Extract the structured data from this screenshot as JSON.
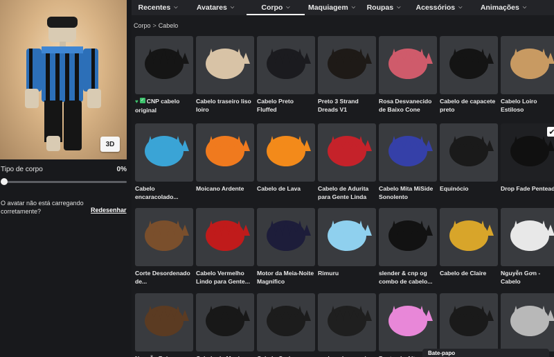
{
  "tabs": [
    {
      "label": "Recentes",
      "active": false
    },
    {
      "label": "Avatares",
      "active": false
    },
    {
      "label": "Corpo",
      "active": true
    },
    {
      "label": "Maquiagem",
      "active": false
    },
    {
      "label": "Roupas",
      "active": false
    },
    {
      "label": "Acessórios",
      "active": false
    },
    {
      "label": "Animações",
      "active": false
    }
  ],
  "avatar": {
    "view_button": "3D"
  },
  "body_type": {
    "label": "Tipo de corpo",
    "value": "0%",
    "value_fraction": 0
  },
  "loading": {
    "message": "O avatar não está carregando corretamente?",
    "redraw": "Redesenhar"
  },
  "breadcrumb": {
    "root": "Corpo",
    "separator": ">",
    "current": "Cabelo"
  },
  "items": [
    {
      "name": "CNP cabelo original",
      "icons": [
        "heart-icon",
        "check-icon"
      ],
      "color": "#151515"
    },
    {
      "name": "Cabelo traseiro liso loiro",
      "color": "#d8c3a6"
    },
    {
      "name": "Cabelo Preto Fluffed",
      "color": "#1b1b1f"
    },
    {
      "name": "Preto 3 Strand Dreads V1",
      "color": "#1e1a17"
    },
    {
      "name": "Rosa Desvanecido de Baixo Cone",
      "color": "#cf5b6b"
    },
    {
      "name": "Cabelo de capacete preto",
      "color": "#141414"
    },
    {
      "name": "Cabelo Loiro Estiloso",
      "color": "#c89a62"
    },
    {
      "name": "Cabelo encaracolado...",
      "color": "#3aa4d6"
    },
    {
      "name": "Moicano Ardente",
      "color": "#f07a1e"
    },
    {
      "name": "Cabelo de Lava",
      "color": "#f38a1a"
    },
    {
      "name": "Cabelo de Adurita para Gente Linda",
      "color": "#c5222a"
    },
    {
      "name": "Cabelo Mita MiSide Sonolento",
      "color": "#3540a8"
    },
    {
      "name": "Equinócio",
      "color": "#1a1a1a"
    },
    {
      "name": "Drop Fade Penteado",
      "color": "#101010",
      "selected": true
    },
    {
      "name": "Corte Desordenado de...",
      "color": "#7a4f2c"
    },
    {
      "name": "Cabelo Vermelho Lindo para Gente...",
      "color": "#c01b1b"
    },
    {
      "name": "Motor da Meia-Noite Magnífico",
      "color": "#1d1d3a"
    },
    {
      "name": "Rimuru",
      "color": "#8fd0ee"
    },
    {
      "name": "slender & cnp og combo de cabelo...",
      "color": "#121212"
    },
    {
      "name": "Cabelo de Claire",
      "color": "#d8a52a"
    },
    {
      "name": "Nguyễn Gơn - Cabelo",
      "color": "#e8e8e8"
    },
    {
      "name": "Nguyễn Bei...",
      "color": "#5b3b22"
    },
    {
      "name": "Cabelo de Manica...",
      "color": "#181818"
    },
    {
      "name": "Cabelo Curly Preto...",
      "color": "#1c1c1c"
    },
    {
      "name": "cachos de crespia...",
      "color": "#1f1f1f"
    },
    {
      "name": "Penteado Alt...",
      "color": "#e887d8"
    },
    {
      "name": "",
      "color": "#1a1a1a"
    },
    {
      "name": "",
      "color": "#b8b8b8"
    }
  ],
  "chat": {
    "label": "Bate-papo"
  }
}
